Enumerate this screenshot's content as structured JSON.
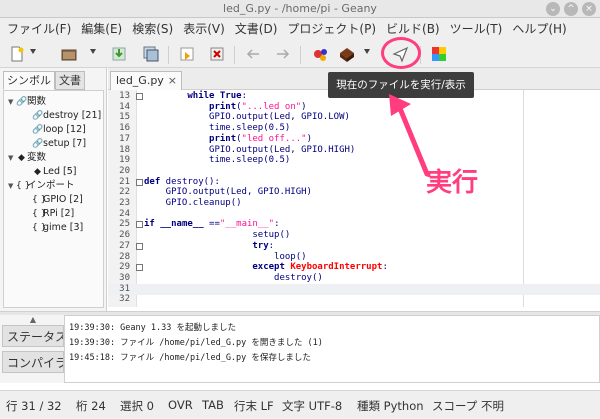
{
  "window": {
    "title": "led_G.py - /home/pi - Geany",
    "controls": [
      "⌄",
      "^",
      "×"
    ]
  },
  "menu": [
    "ファイル(F)",
    "編集(E)",
    "検索(S)",
    "表示(V)",
    "文書(D)",
    "プロジェクト(P)",
    "ビルド(B)",
    "ツール(T)",
    "ヘルプ(H)"
  ],
  "toolbar": {
    "icons": [
      "new-file-icon",
      "open-file-icon",
      "save-icon",
      "save-all-icon",
      "revert-icon",
      "close-icon",
      "back-arrow-icon",
      "forward-arrow-icon",
      "compile-icon",
      "build-icon",
      "execute-icon",
      "color-chooser-icon"
    ],
    "tooltip": "現在のファイルを実行/表示"
  },
  "sidebar": {
    "tabs": [
      "シンボル",
      "文書"
    ],
    "tree": [
      {
        "label": "関数",
        "twisty": "▼",
        "icon": "🔗"
      },
      {
        "label": "destroy [21]",
        "twisty": "",
        "icon": "🔗"
      },
      {
        "label": "loop [12]",
        "twisty": "",
        "icon": "🔗"
      },
      {
        "label": "setup [7]",
        "twisty": "",
        "icon": "🔗"
      },
      {
        "label": "変数",
        "twisty": "▼",
        "icon": "◆"
      },
      {
        "label": "Led [5]",
        "twisty": "",
        "icon": "◆"
      },
      {
        "label": "インポート",
        "twisty": "▼",
        "icon": "{ }"
      },
      {
        "label": "GPIO [2]",
        "twisty": "",
        "icon": "{ }"
      },
      {
        "label": "RPi [2]",
        "twisty": "",
        "icon": "{ }"
      },
      {
        "label": "gime [3]",
        "twisty": "",
        "icon": "{ }"
      }
    ]
  },
  "editor": {
    "tab": {
      "label": "led_G.py",
      "close": "×"
    },
    "lines": [
      {
        "n": "13",
        "fold": true,
        "segs": [
          {
            "t": "        ",
            "c": ""
          },
          {
            "t": "while",
            "c": "k"
          },
          {
            "t": " ",
            "c": ""
          },
          {
            "t": "True",
            "c": "k"
          },
          {
            "t": ":",
            "c": ""
          }
        ]
      },
      {
        "n": "14",
        "fold": false,
        "segs": [
          {
            "t": "            ",
            "c": ""
          },
          {
            "t": "print",
            "c": "k"
          },
          {
            "t": "(",
            "c": ""
          },
          {
            "t": "\"...led on\"",
            "c": "s"
          },
          {
            "t": ")",
            "c": ""
          }
        ]
      },
      {
        "n": "15",
        "fold": false,
        "segs": [
          {
            "t": "            GPIO.output(Led, GPIO.LOW)",
            "c": ""
          }
        ]
      },
      {
        "n": "16",
        "fold": false,
        "segs": [
          {
            "t": "            time.sleep(0.5)",
            "c": ""
          }
        ]
      },
      {
        "n": "17",
        "fold": false,
        "segs": [
          {
            "t": "            ",
            "c": ""
          },
          {
            "t": "print",
            "c": "k"
          },
          {
            "t": "(",
            "c": ""
          },
          {
            "t": "\"led off...\"",
            "c": "s"
          },
          {
            "t": ")",
            "c": ""
          }
        ]
      },
      {
        "n": "18",
        "fold": false,
        "segs": [
          {
            "t": "            GPIO.output(Led, GPIO.HIGH)",
            "c": ""
          }
        ]
      },
      {
        "n": "19",
        "fold": false,
        "segs": [
          {
            "t": "            time.sleep(0.5)",
            "c": ""
          }
        ]
      },
      {
        "n": "20",
        "fold": false,
        "segs": []
      },
      {
        "n": "21",
        "fold": true,
        "segs": [
          {
            "t": "def",
            "c": "k"
          },
          {
            "t": " destroy():",
            "c": ""
          }
        ]
      },
      {
        "n": "22",
        "fold": false,
        "segs": [
          {
            "t": "    GPIO.output(Led, GPIO.HIGH)",
            "c": ""
          }
        ]
      },
      {
        "n": "23",
        "fold": false,
        "segs": [
          {
            "t": "    GPIO.cleanup()",
            "c": ""
          }
        ]
      },
      {
        "n": "24",
        "fold": false,
        "segs": []
      },
      {
        "n": "25",
        "fold": true,
        "segs": [
          {
            "t": "if",
            "c": "k"
          },
          {
            "t": " ",
            "c": ""
          },
          {
            "t": "__name__",
            "c": "k"
          },
          {
            "t": " ==",
            "c": ""
          },
          {
            "t": "\"__main__\"",
            "c": "s"
          },
          {
            "t": ":",
            "c": ""
          }
        ]
      },
      {
        "n": "26",
        "fold": false,
        "segs": [
          {
            "t": "                    setup()",
            "c": ""
          }
        ]
      },
      {
        "n": "27",
        "fold": true,
        "segs": [
          {
            "t": "                    ",
            "c": ""
          },
          {
            "t": "try",
            "c": "k"
          },
          {
            "t": ":",
            "c": ""
          }
        ]
      },
      {
        "n": "28",
        "fold": false,
        "segs": [
          {
            "t": "                        loop()",
            "c": ""
          }
        ]
      },
      {
        "n": "29",
        "fold": true,
        "segs": [
          {
            "t": "                    ",
            "c": ""
          },
          {
            "t": "except",
            "c": "k"
          },
          {
            "t": " ",
            "c": ""
          },
          {
            "t": "KeyboardInterrupt",
            "c": "e"
          },
          {
            "t": ":",
            "c": ""
          }
        ]
      },
      {
        "n": "30",
        "fold": false,
        "segs": [
          {
            "t": "                        destroy()",
            "c": ""
          }
        ]
      },
      {
        "n": "31",
        "fold": false,
        "segs": [],
        "current": true
      },
      {
        "n": "32",
        "fold": false,
        "segs": []
      }
    ]
  },
  "messages": {
    "tabs": [
      "ステータス",
      "コンパイラ"
    ],
    "tab_marker": "▲",
    "lines": [
      "19:39:30: Geany 1.33 を起動しました",
      "19:39:30: ファイル /home/pi/led_G.py を開きました (1)",
      "19:45:18: ファイル /home/pi/led_G.py を保存しました"
    ]
  },
  "statusbar": [
    "行 31 / 32",
    "桁 24",
    "選択 0",
    "OVR",
    "TAB",
    "行末 LF",
    "文字 UTF-8",
    "種類 Python",
    "スコープ 不明"
  ],
  "annotation": {
    "label": "実行",
    "color": "#ff3d7f"
  }
}
